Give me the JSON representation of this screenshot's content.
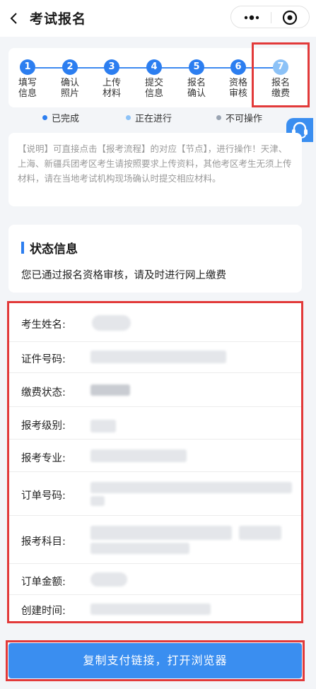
{
  "nav": {
    "title": "考试报名"
  },
  "steps": [
    {
      "num": "1",
      "line1": "填写",
      "line2": "信息",
      "state": "done"
    },
    {
      "num": "2",
      "line1": "确认",
      "line2": "照片",
      "state": "done"
    },
    {
      "num": "3",
      "line1": "上传",
      "line2": "材料",
      "state": "done"
    },
    {
      "num": "4",
      "line1": "提交",
      "line2": "信息",
      "state": "done"
    },
    {
      "num": "5",
      "line1": "报名",
      "line2": "确认",
      "state": "done"
    },
    {
      "num": "6",
      "line1": "资格",
      "line2": "审核",
      "state": "done"
    },
    {
      "num": "7",
      "line1": "报名",
      "line2": "缴费",
      "state": "current"
    }
  ],
  "legend": {
    "done": "已完成",
    "current": "正在进行",
    "disabled": "不可操作"
  },
  "colors": {
    "done": "#2c7ef0",
    "current": "#8cc2f7",
    "disabled": "#9aa4b2",
    "highlight": "#e23a3a",
    "button": "#3a8ef0"
  },
  "notice": {
    "text": "【说明】可直接点击【报考流程】的对应【节点】，进行操作！天津、上海、新疆兵团考区考生请按照要求上传资料，其他考区考生无须上传材料，请在当地考试机构现场确认时提交相应材料。"
  },
  "status": {
    "title": "状态信息",
    "text": "您已通过报名资格审核，请及时进行网上缴费"
  },
  "info_rows": [
    {
      "label": "考生姓名:"
    },
    {
      "label": "证件号码:"
    },
    {
      "label": "缴费状态:"
    },
    {
      "label": "报考级别:"
    },
    {
      "label": "报考专业:"
    },
    {
      "label": "订单号码:"
    },
    {
      "label": "报考科目:"
    },
    {
      "label": "订单金额:"
    },
    {
      "label": "创建时间:"
    }
  ],
  "button": {
    "label": "复制支付链接，打开浏览器"
  }
}
